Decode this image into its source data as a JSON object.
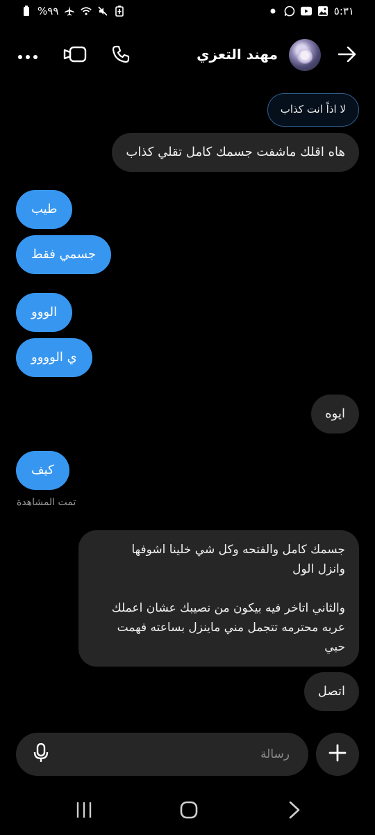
{
  "status_bar": {
    "time": "٥:٣١",
    "battery": "%٩٩",
    "left_icons": [
      "battery-icon",
      "airplane-icon",
      "wifi-icon",
      "mute-icon",
      "battery-saver-icon"
    ],
    "right_icons": [
      "dot-icon",
      "chat-notification-icon",
      "youtube-icon",
      "gallery-icon"
    ]
  },
  "header": {
    "contact_name": "مهند التعزي",
    "icons": [
      "back-arrow-icon",
      "avatar",
      "call-icon",
      "video-call-icon",
      "more-options-icon"
    ]
  },
  "messages": [
    {
      "id": "m0",
      "sender": "other",
      "text": "لا اذاً انت كذاب",
      "kind": "replied-preview"
    },
    {
      "id": "m1",
      "sender": "other",
      "text": "هاه اقلك ماشفت جسمك كامل تقلي كذاب"
    },
    {
      "id": "m2",
      "sender": "me",
      "text": "طيب"
    },
    {
      "id": "m3",
      "sender": "me",
      "text": "جسمي فقط"
    },
    {
      "id": "m4",
      "sender": "me",
      "text": "الووو"
    },
    {
      "id": "m5",
      "sender": "me",
      "text": "ي الوووو"
    },
    {
      "id": "m6",
      "sender": "other",
      "text": "ايوه"
    },
    {
      "id": "m7",
      "sender": "me",
      "text": "كيف"
    },
    {
      "id": "m8",
      "sender": "other",
      "text": "جسمك كامل والفتحه وكل شي خلينا اشوفها\nوانزل الول\n\nوالثاني اتاخر فيه بيكون من نصيبك عشان اعملك\nعربه محترمه تتجمل مني ماينزل بساعته فهمت\nحبي"
    },
    {
      "id": "m9",
      "sender": "other",
      "text": "اتصل"
    }
  ],
  "seen_label": "تمت المشاهدة",
  "composer": {
    "placeholder": "رسالة",
    "value": ""
  },
  "colors": {
    "background": "#000000",
    "outgoing_bubble": "#3797f0",
    "incoming_bubble": "#262626"
  }
}
